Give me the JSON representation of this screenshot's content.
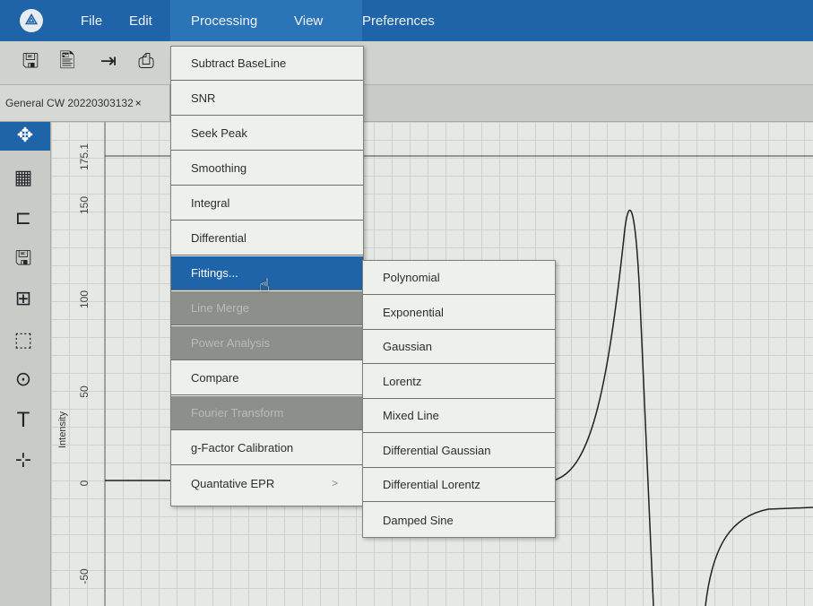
{
  "menubar": {
    "items": [
      {
        "label": "File"
      },
      {
        "label": "Edit"
      },
      {
        "label": "Processing"
      },
      {
        "label": "View"
      },
      {
        "label": "Preferences"
      }
    ],
    "logo_icon": "app-logo-icon"
  },
  "toolbar": {
    "buttons": [
      "save-icon",
      "save-as-icon",
      "export-icon",
      "print-icon"
    ]
  },
  "tab": {
    "label": "General CW 20220303132",
    "close": "×"
  },
  "tools": [
    "move-icon",
    "grid-icon",
    "zoom-box-icon",
    "save-view-icon",
    "add-icon",
    "select-icon",
    "peak-icon",
    "text-icon",
    "axis-move-icon"
  ],
  "plot": {
    "ylabel": "Intensity",
    "yticks": [
      "175.1",
      "150",
      "100",
      "50",
      "0",
      "-50"
    ]
  },
  "processing_menu": {
    "items": [
      {
        "label": "Subtract BaseLine",
        "state": "normal"
      },
      {
        "label": "SNR",
        "state": "normal"
      },
      {
        "label": "Seek Peak",
        "state": "normal"
      },
      {
        "label": "Smoothing",
        "state": "normal"
      },
      {
        "label": "Integral",
        "state": "normal"
      },
      {
        "label": "Differential",
        "state": "normal"
      },
      {
        "label": "Fittings...",
        "state": "highlight"
      },
      {
        "label": "Line Merge",
        "state": "disabled"
      },
      {
        "label": "Power Analysis",
        "state": "disabled"
      },
      {
        "label": "Compare",
        "state": "normal"
      },
      {
        "label": "Fourier Transform",
        "state": "disabled"
      },
      {
        "label": "g-Factor Calibration",
        "state": "normal"
      },
      {
        "label": "Quantative EPR",
        "state": "normal",
        "submenu_arrow": ">"
      }
    ]
  },
  "fittings_submenu": {
    "items": [
      {
        "label": "Polynomial"
      },
      {
        "label": "Exponential"
      },
      {
        "label": "Gaussian"
      },
      {
        "label": "Lorentz"
      },
      {
        "label": "Mixed Line"
      },
      {
        "label": "Differential Gaussian"
      },
      {
        "label": "Differential Lorentz"
      },
      {
        "label": "Damped Sine"
      }
    ]
  },
  "colors": {
    "accent": "#1f64a8",
    "menu_bg": "#eef0ec",
    "disabled_bg": "#8c8f8a"
  }
}
